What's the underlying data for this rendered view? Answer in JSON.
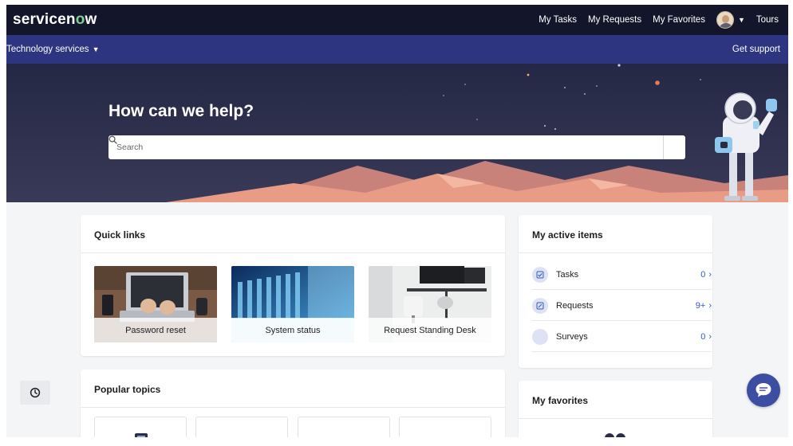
{
  "brand": {
    "logo_prefix": "servicen",
    "logo_accent": "o",
    "logo_suffix": "w"
  },
  "topnav": {
    "links": [
      "My Tasks",
      "My Requests",
      "My Favorites"
    ],
    "tours": "Tours"
  },
  "subnav": {
    "menu": "Technology services",
    "support": "Get support"
  },
  "hero": {
    "title": "How can we help?",
    "search_placeholder": "Search"
  },
  "quick_links": {
    "title": "Quick links",
    "tiles": [
      {
        "label": "Password reset"
      },
      {
        "label": "System status"
      },
      {
        "label": "Request Standing Desk"
      }
    ]
  },
  "active_items": {
    "title": "My active items",
    "rows": [
      {
        "label": "Tasks",
        "count": "0",
        "icon": "check-icon"
      },
      {
        "label": "Requests",
        "count": "9+",
        "icon": "edit-icon"
      },
      {
        "label": "Surveys",
        "count": "0",
        "icon": "survey-icon"
      }
    ]
  },
  "popular_topics": {
    "title": "Popular topics"
  },
  "favorites": {
    "title": "My favorites"
  },
  "colors": {
    "topnav": "#13162b",
    "subnav": "#2d3580",
    "hero": "#2c2e4a",
    "mountains": "#e89b85",
    "link_accent": "#3659c3",
    "chat": "#3b4ea2",
    "logo_accent": "#7ed08f"
  }
}
